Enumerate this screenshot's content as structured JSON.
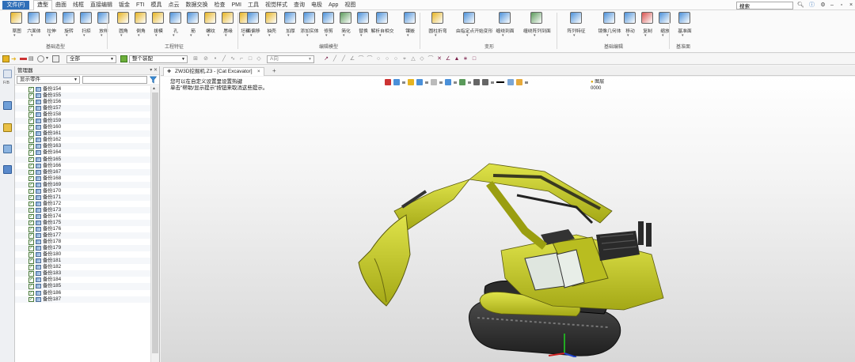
{
  "menubar": {
    "file_label": "文件(F)",
    "tabs": [
      "造型",
      "曲面",
      "线框",
      "直接编辑",
      "钣金",
      "FTI",
      "模具",
      "点云",
      "数据交换",
      "检查",
      "PMI",
      "工具",
      "视觉样式",
      "查询",
      "电极",
      "App",
      "视图"
    ],
    "active_tab": "造型",
    "search_value": "搜索",
    "icons": [
      "search-icon",
      "help-icon",
      "settings-icon",
      "minimize-icon",
      "restore-icon",
      "close-icon"
    ]
  },
  "ribbon": {
    "buttons": [
      "草图",
      "六面体",
      "拉伸",
      "旋转",
      "扫掠",
      "放样",
      "圆角",
      "倒角",
      "拔模",
      "孔",
      "筋",
      "螺纹",
      "唇缘",
      "坯料",
      "面偏移",
      "抽壳",
      "加厚",
      "添加实体",
      "修剪",
      "简化",
      "替换",
      "解析自相交",
      "镶嵌",
      "圆柱折弯",
      "由指定点开始变形",
      "缠绕到面",
      "缠绕阵列到面",
      "阵列特征",
      "镜像几何体",
      "移动",
      "复制",
      "缩放",
      "基准面"
    ],
    "groups": [
      "基础造型",
      "工程特征",
      "编辑模型",
      "变形",
      "基础编辑",
      "基准面"
    ]
  },
  "toolbar2": {
    "filter_value": "全部",
    "pick_value": "整个装配",
    "snap_value": "A向"
  },
  "manager": {
    "title": "管理器",
    "filter_value": "显示零件",
    "rows_prefix": "备份",
    "rows": [
      "备份154",
      "备份155",
      "备份156",
      "备份157",
      "备份158",
      "备份159",
      "备份160",
      "备份161",
      "备份162",
      "备份163",
      "备份164",
      "备份165",
      "备份166",
      "备份167",
      "备份168",
      "备份169",
      "备份170",
      "备份171",
      "备份172",
      "备份173",
      "备份174",
      "备份175",
      "备份176",
      "备份177",
      "备份178",
      "备份179",
      "备份180",
      "备份181",
      "备份182",
      "备份183",
      "备份184",
      "备份185",
      "备份186",
      "备份187"
    ]
  },
  "document": {
    "tab_title": "ZW3D挖掘机.Z3 - [Cat Excavator]",
    "hint_line1": "您可以在自定义设置里设置热键",
    "hint_line2": "单击\"帮助/显示提示\"按钮来取消这些提示。",
    "layer_value": "图层0000"
  },
  "colors": {
    "accent": "#2f6fb8",
    "excavator_body": "#c2c62a",
    "excavator_dark": "#4a4a3a"
  }
}
